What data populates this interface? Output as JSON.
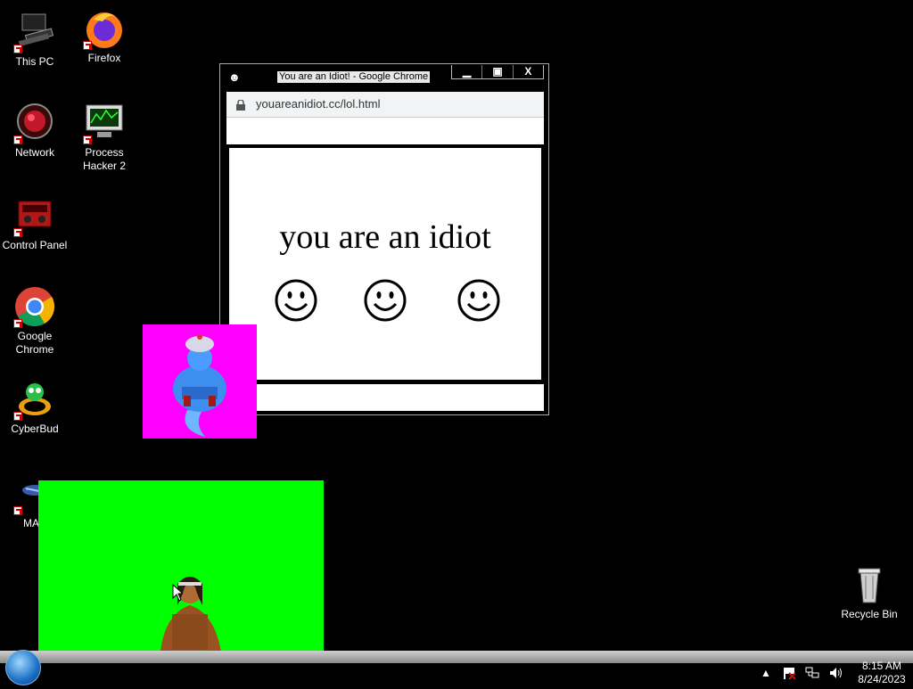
{
  "desktop": {
    "icons": [
      {
        "label": "This PC"
      },
      {
        "label": "Firefox"
      },
      {
        "label": "Network"
      },
      {
        "label": "Process Hacker 2"
      },
      {
        "label": "Control Panel"
      },
      {
        "label": "Google Chrome"
      },
      {
        "label": "CyberBud"
      },
      {
        "label": "MAS"
      },
      {
        "label": "Recycle Bin"
      }
    ]
  },
  "popup": {
    "title": "You are an Idiot! - Google Chrome",
    "url": "youareanidiot.cc/lol.html",
    "headline": "you are an idiot",
    "controls": {
      "minimize": "▁",
      "maximize": "▣",
      "close": "X"
    }
  },
  "taskbar": {
    "clock": {
      "time": "8:15 AM",
      "date": "8/24/2023"
    },
    "tray_icons": [
      "chevron-up-icon",
      "flag-icon",
      "network-icon",
      "volume-icon"
    ]
  },
  "colors": {
    "genie_bg": "#ff00ff",
    "monk_bg": "#00ff00",
    "desktop": "#000000"
  }
}
